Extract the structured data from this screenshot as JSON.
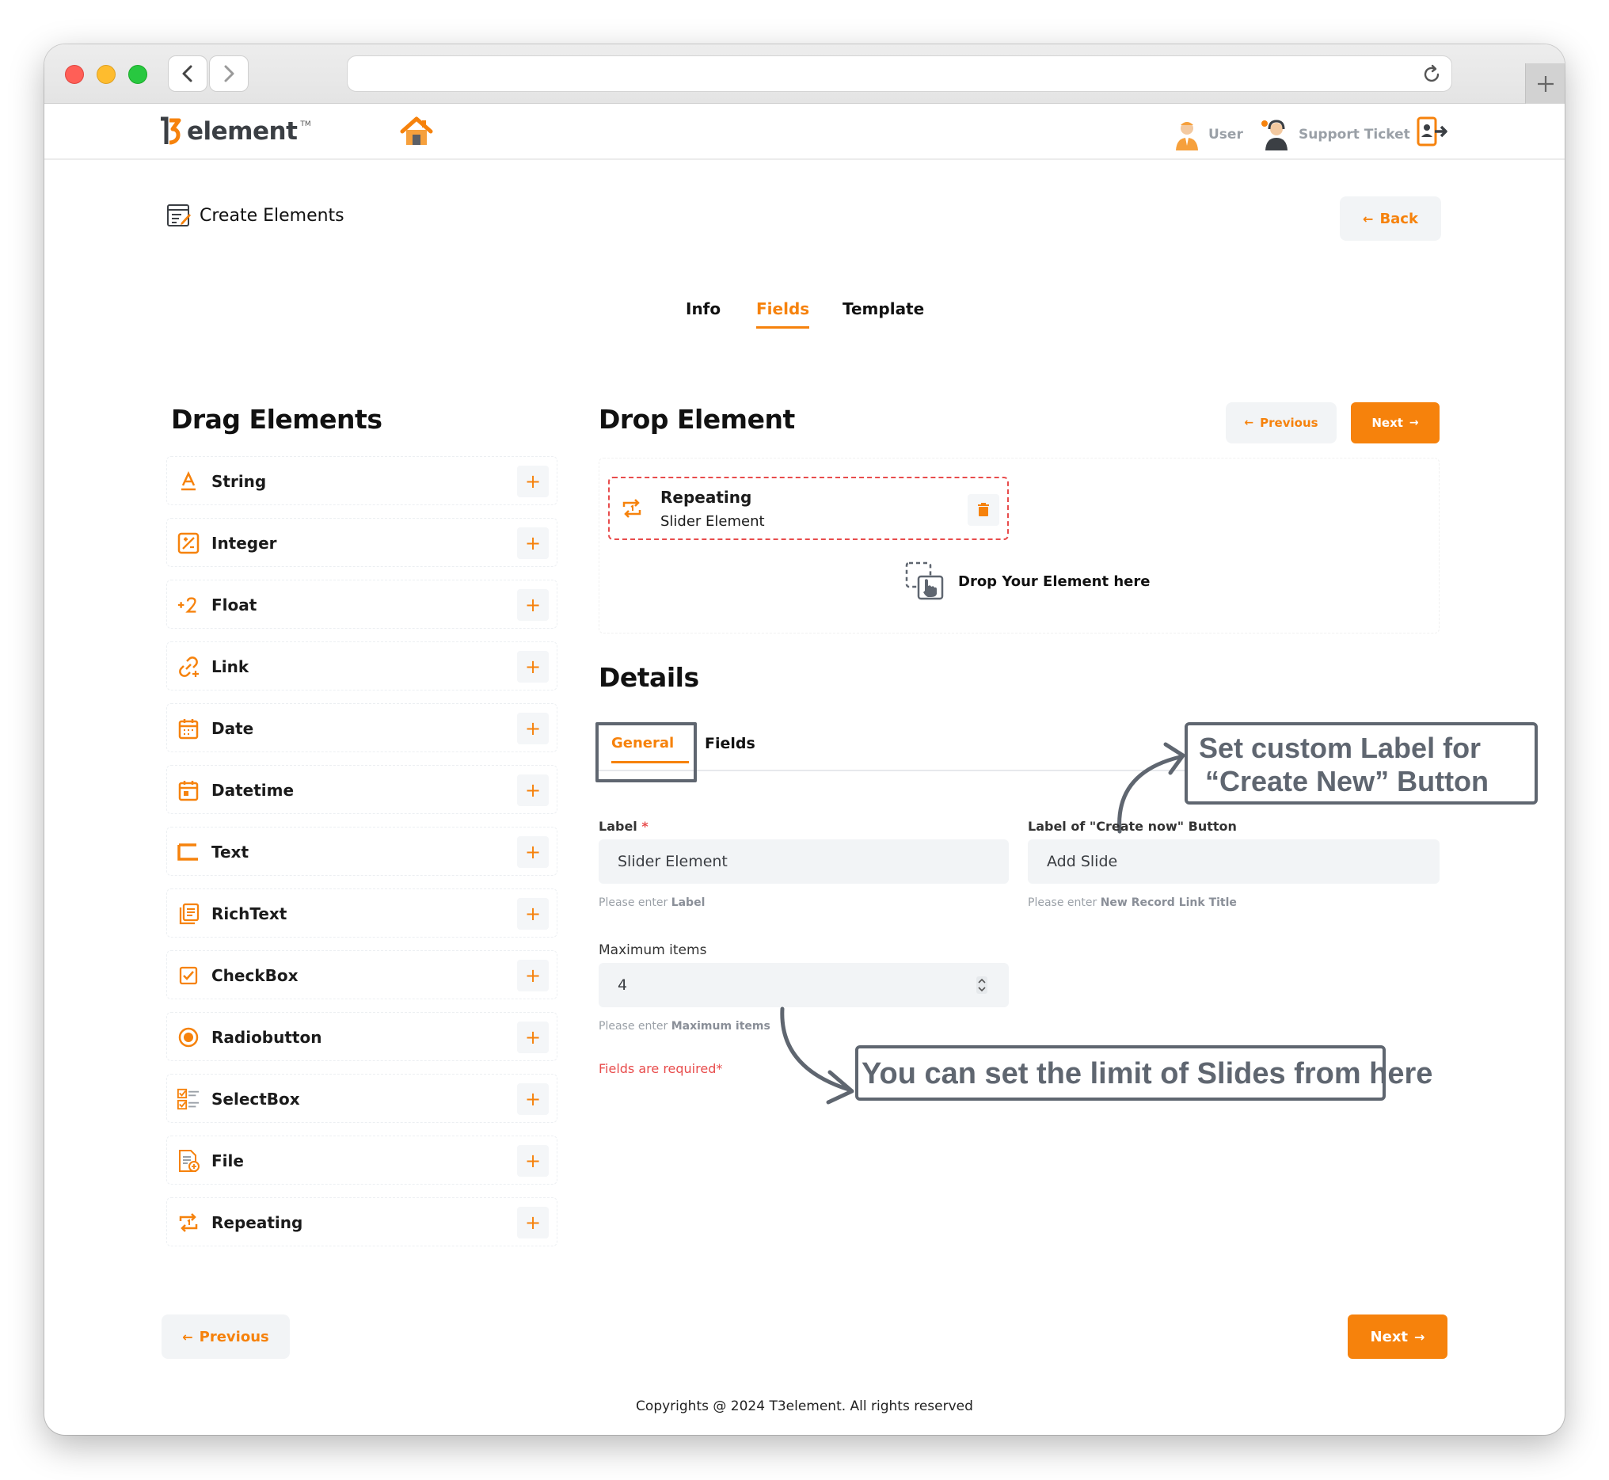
{
  "brand": {
    "logo_text": "element",
    "logo_tm": "TM"
  },
  "header": {
    "user_label": "User",
    "support_label": "Support Ticket"
  },
  "page": {
    "title": "Create Elements",
    "back_label": "Back"
  },
  "tabs": [
    {
      "label": "Info",
      "active": false
    },
    {
      "label": "Fields",
      "active": true
    },
    {
      "label": "Template",
      "active": false
    }
  ],
  "drag": {
    "title": "Drag Elements",
    "items": [
      {
        "label": "String",
        "icon": "string-icon"
      },
      {
        "label": "Integer",
        "icon": "integer-icon"
      },
      {
        "label": "Float",
        "icon": "float-icon"
      },
      {
        "label": "Link",
        "icon": "link-icon"
      },
      {
        "label": "Date",
        "icon": "calendar-icon"
      },
      {
        "label": "Datetime",
        "icon": "datetime-icon"
      },
      {
        "label": "Text",
        "icon": "text-icon"
      },
      {
        "label": "RichText",
        "icon": "richtext-icon"
      },
      {
        "label": "CheckBox",
        "icon": "checkbox-icon"
      },
      {
        "label": "Radiobutton",
        "icon": "radio-icon"
      },
      {
        "label": "SelectBox",
        "icon": "selectbox-icon"
      },
      {
        "label": "File",
        "icon": "file-icon"
      },
      {
        "label": "Repeating",
        "icon": "repeat-icon"
      }
    ]
  },
  "drop": {
    "title": "Drop Element",
    "previous_label": "Previous",
    "next_label": "Next",
    "card": {
      "type": "Repeating",
      "name": "Slider Element"
    },
    "placeholder": "Drop Your Element here"
  },
  "details": {
    "title": "Details",
    "subtabs": [
      {
        "label": "General",
        "active": true
      },
      {
        "label": "Fields",
        "active": false
      }
    ],
    "label_field": {
      "label": "Label",
      "required_mark": "*",
      "value": "Slider Element",
      "help_prefix": "Please enter",
      "help_key": "Label"
    },
    "create_label_field": {
      "label": "Label of \"Create now\" Button",
      "value": "Add Slide",
      "help_prefix": "Please enter",
      "help_key": "New Record Link Title"
    },
    "max_items_field": {
      "label": "Maximum items",
      "value": "4",
      "help_prefix": "Please enter",
      "help_key": "Maximum items"
    },
    "required_note": "Fields are required*"
  },
  "annotations": {
    "custom_label_line1": "Set custom Label for",
    "custom_label_line2": "“Create New” Button",
    "limit_note": "You can set the limit of Slides from here"
  },
  "bottom": {
    "previous_label": "Previous",
    "next_label": "Next"
  },
  "footer": {
    "copyright": "Copyrights @ 2024 T3element. All rights reserved"
  },
  "colors": {
    "accent": "#f6820c",
    "error": "#e84c4c",
    "annotation": "#5f6670"
  }
}
